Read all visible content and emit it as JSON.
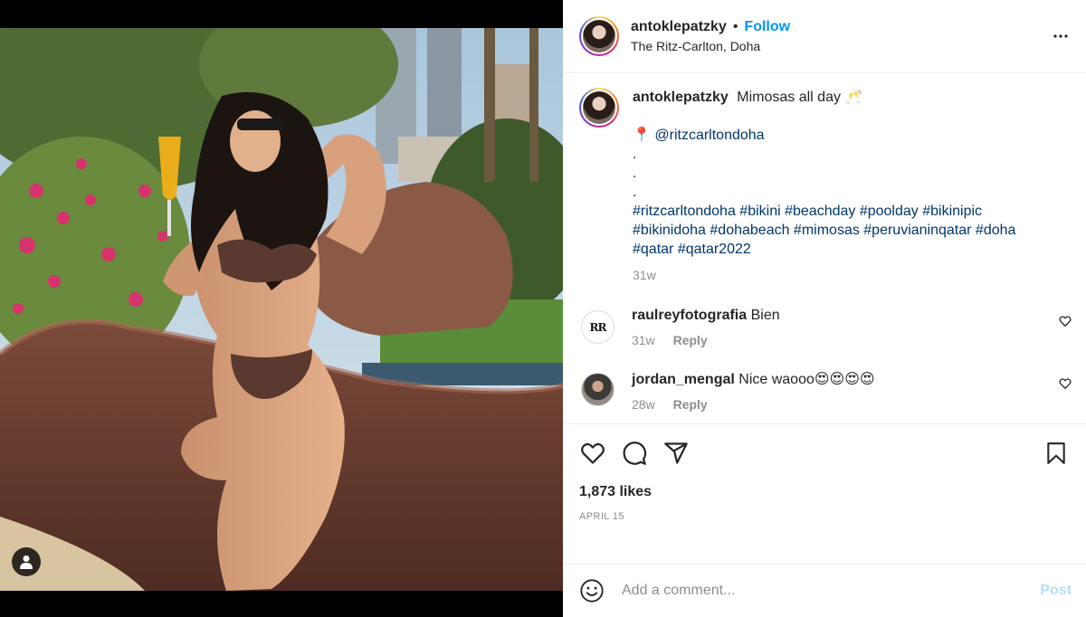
{
  "post": {
    "username": "antoklepatzky",
    "follow_label": "Follow",
    "separator": "•",
    "location": "The Ritz-Carlton, Doha"
  },
  "caption": {
    "username": "antoklepatzky",
    "text": "Mimosas all day 🥂",
    "pin": "📍",
    "mention": "@ritzcarltondoha",
    "dots": ".",
    "hashtags": "#ritzcarltondoha #bikini #beachday #poolday #bikinipic #bikinidoha #dohabeach #mimosas #peruvianinqatar #doha #qatar #qatar2022",
    "age": "31w"
  },
  "comments": [
    {
      "username": "raulreyfotografia",
      "text": "Bien",
      "avatar_text": "RR",
      "age": "31w",
      "reply_label": "Reply"
    },
    {
      "username": "jordan_mengal",
      "text": "Nice waooo😍😍😍😍",
      "age": "28w",
      "reply_label": "Reply"
    }
  ],
  "actions": {
    "likes": "1,873 likes",
    "date": "APRIL 15"
  },
  "composer": {
    "placeholder": "Add a comment...",
    "post_label": "Post"
  },
  "icons": {
    "more": "more-options-icon",
    "user_tag": "user-tags-icon",
    "like": "heart-icon",
    "comment": "comment-icon",
    "share": "share-icon",
    "save": "bookmark-icon",
    "emoji": "emoji-icon"
  },
  "colors": {
    "follow": "#0095f6",
    "hashtag": "#00376b",
    "post_disabled": "#b2dffc",
    "muted": "#8e8e8e"
  }
}
